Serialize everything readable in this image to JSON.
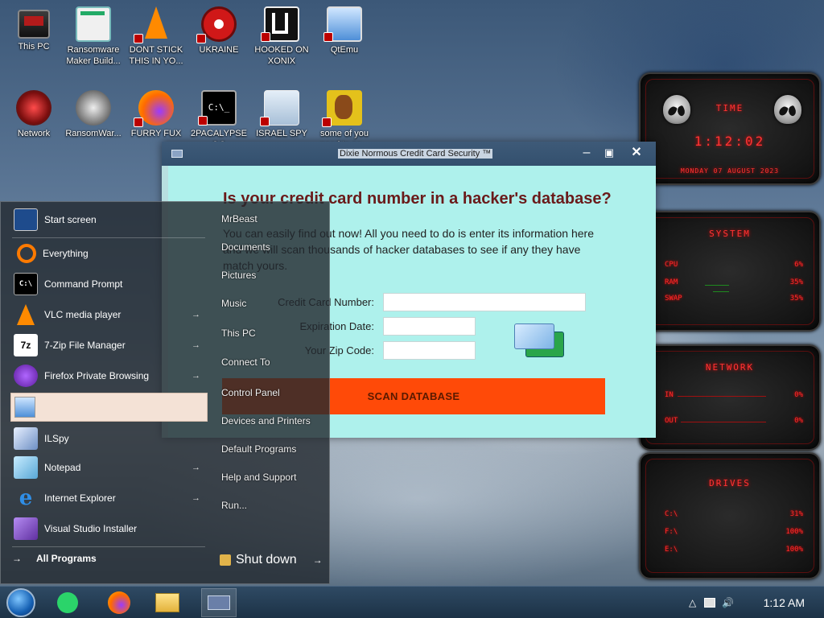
{
  "desktop_icons": [
    {
      "label": "This PC"
    },
    {
      "label": "Ransomware Maker Build..."
    },
    {
      "label": "DONT STICK THIS IN YO..."
    },
    {
      "label": "UKRAINE"
    },
    {
      "label": "HOOKED ON XONIX"
    },
    {
      "label": "QtEmu"
    },
    {
      "label": "Network"
    },
    {
      "label": "RansomWar..."
    },
    {
      "label": "FURRY FUX"
    },
    {
      "label": "2PACALYPSE 2.3"
    },
    {
      "label": "ISRAEL SPY"
    },
    {
      "label": "some of you need to se..."
    }
  ],
  "gadget": {
    "time_title": "TIME",
    "time": "1:12:02",
    "date": "MONDAY 07 AUGUST 2023",
    "system_title": "SYSTEM",
    "cpu_label": "CPU",
    "cpu_value": "6%",
    "ram_label": "RAM",
    "ram_value": "35%",
    "swap_label": "SWAP",
    "swap_value": "35%",
    "network_title": "NETWORK",
    "in_label": "IN",
    "in_value": "0%",
    "out_label": "OUT",
    "out_value": "0%",
    "drives_title": "DRIVES",
    "drives": [
      {
        "label": "C:\\",
        "value": "31%"
      },
      {
        "label": "F:\\",
        "value": "100%"
      },
      {
        "label": "E:\\",
        "value": "100%"
      }
    ]
  },
  "app_window": {
    "title": "Dixie Normous Credit Card Security ™",
    "heading": "Is your credit card number in a hacker's database?",
    "description": "You can easily find out now! All you need to do is enter its information here and we will scan thousands of hacker databases to see if any they have match yours.",
    "card_label": "Credit Card Number:",
    "expiry_label": "Expiration Date:",
    "zip_label": "Your Zip Code:",
    "card_value": "",
    "expiry_value": "",
    "zip_value": "",
    "scan_label": "SCAN DATABASE",
    "minimize": "–",
    "maximize": "▣",
    "close": "✕"
  },
  "start_menu": {
    "left_items": [
      {
        "label": "Start screen",
        "icon": "start-screen-icon"
      },
      {
        "label": "Everything",
        "icon": "search-icon"
      },
      {
        "label": "Command Prompt",
        "icon": "cmd-icon"
      },
      {
        "label": "VLC media player",
        "icon": "vlc-icon"
      },
      {
        "label": "7-Zip File Manager",
        "icon": "7zip-icon"
      },
      {
        "label": "Firefox Private Browsing",
        "icon": "firefox-private-icon"
      },
      {
        "label": "",
        "icon": "computer-icon"
      },
      {
        "label": "ILSpy",
        "icon": "ilspy-icon"
      },
      {
        "label": "Notepad",
        "icon": "notepad-icon"
      },
      {
        "label": "Internet Explorer",
        "icon": "ie-icon"
      },
      {
        "label": "Visual Studio Installer",
        "icon": "vs-installer-icon"
      }
    ],
    "all_programs": "All Programs",
    "right_items": [
      "MrBeast",
      "Documents",
      "Pictures",
      "Music",
      "This PC",
      "Connect To",
      "Control Panel",
      "Devices and Printers",
      "Default Programs",
      "Help and Support",
      "Run..."
    ],
    "shutdown": "Shut down",
    "arrow": "→"
  },
  "taskbar": {
    "apps": [
      "start-orb",
      "google-keep",
      "firefox",
      "file-explorer",
      "credit-card-app"
    ],
    "clock": "1:12 AM",
    "tray_up": "△",
    "volume": "🔊"
  }
}
